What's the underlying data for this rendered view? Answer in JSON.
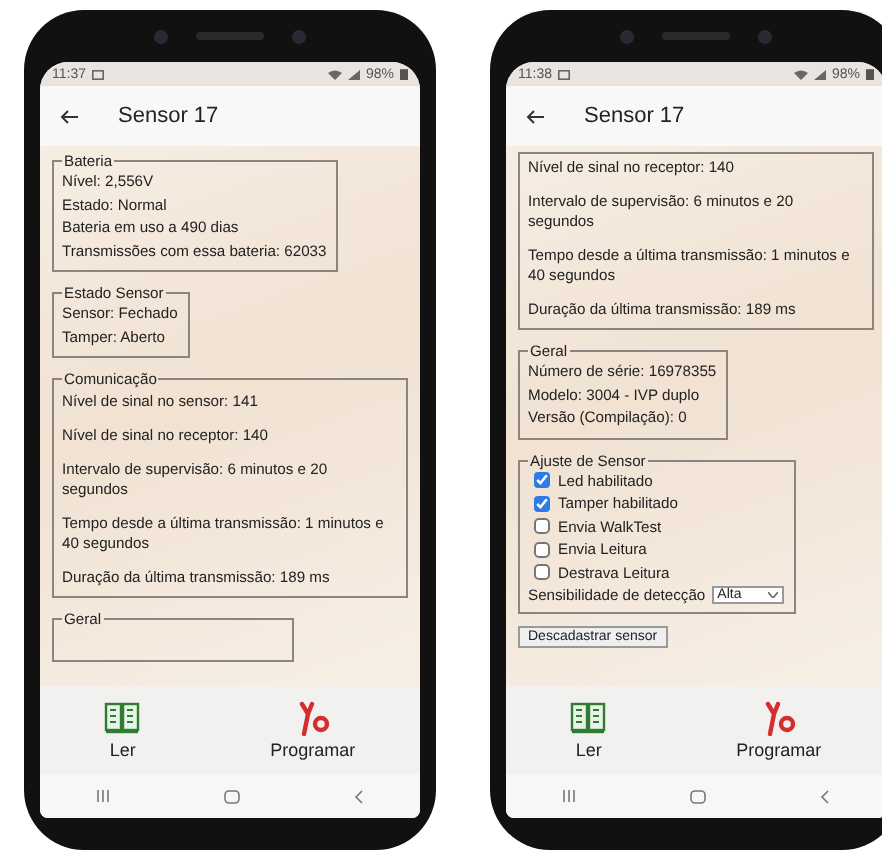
{
  "phones": [
    {
      "status_bar": {
        "time": "11:37",
        "battery": "98%"
      },
      "title": "Sensor 17",
      "sections": [
        {
          "kind": "lines",
          "title": "Bateria",
          "lines": [
            "Nível: 2,556V",
            "Estado: Normal",
            "Bateria em uso a 490 dias",
            "Transmissões com essa bateria: 62033"
          ]
        },
        {
          "kind": "lines",
          "title": "Estado Sensor",
          "lines": [
            "Sensor: Fechado",
            "Tamper: Aberto"
          ]
        },
        {
          "kind": "paragraphs",
          "title": "Comunicação",
          "lines": [
            "Nível de sinal no sensor: 141",
            "Nível de sinal no receptor: 140",
            "Intervalo de supervisão: 6 minutos e 20 segundos",
            "Tempo desde a última transmissão: 1 minutos e 40 segundos",
            "Duração da última transmissão: 189 ms"
          ]
        },
        {
          "kind": "lines",
          "title": "Geral"
        }
      ],
      "nav": [
        {
          "label": "Ler",
          "kind": "read"
        },
        {
          "label": "Programar",
          "kind": "program"
        }
      ]
    },
    {
      "status_bar": {
        "time": "11:38",
        "battery": "98%"
      },
      "title": "Sensor 17",
      "sections": [
        {
          "kind": "paragraphs",
          "lines": [
            "Nível de sinal no receptor: 140",
            "Intervalo de supervisão: 6 minutos e 20 segundos",
            "Tempo desde a última transmissão: 1 minutos e 40 segundos",
            "Duração da última transmissão: 189 ms"
          ]
        },
        {
          "kind": "lines",
          "title": "Geral",
          "lines": [
            "Número de série: 16978355",
            "Modelo: 3004 - IVP duplo",
            "Versão (Compilação): 0"
          ]
        },
        {
          "kind": "settings",
          "title": "Ajuste de Sensor",
          "options": [
            {
              "label": "Led habilitado",
              "checked": true
            },
            {
              "label": "Tamper habilitado",
              "checked": true
            },
            {
              "label": "Envia WalkTest",
              "checked": false
            },
            {
              "label": "Envia Leitura",
              "checked": false
            },
            {
              "label": "Destrava Leitura",
              "checked": false
            }
          ],
          "select": {
            "label": "Sensibilidade de detecção",
            "value": "Alta"
          }
        }
      ],
      "button": "Descadastrar sensor",
      "nav": [
        {
          "label": "Ler",
          "kind": "read"
        },
        {
          "label": "Programar",
          "kind": "program"
        }
      ]
    }
  ]
}
